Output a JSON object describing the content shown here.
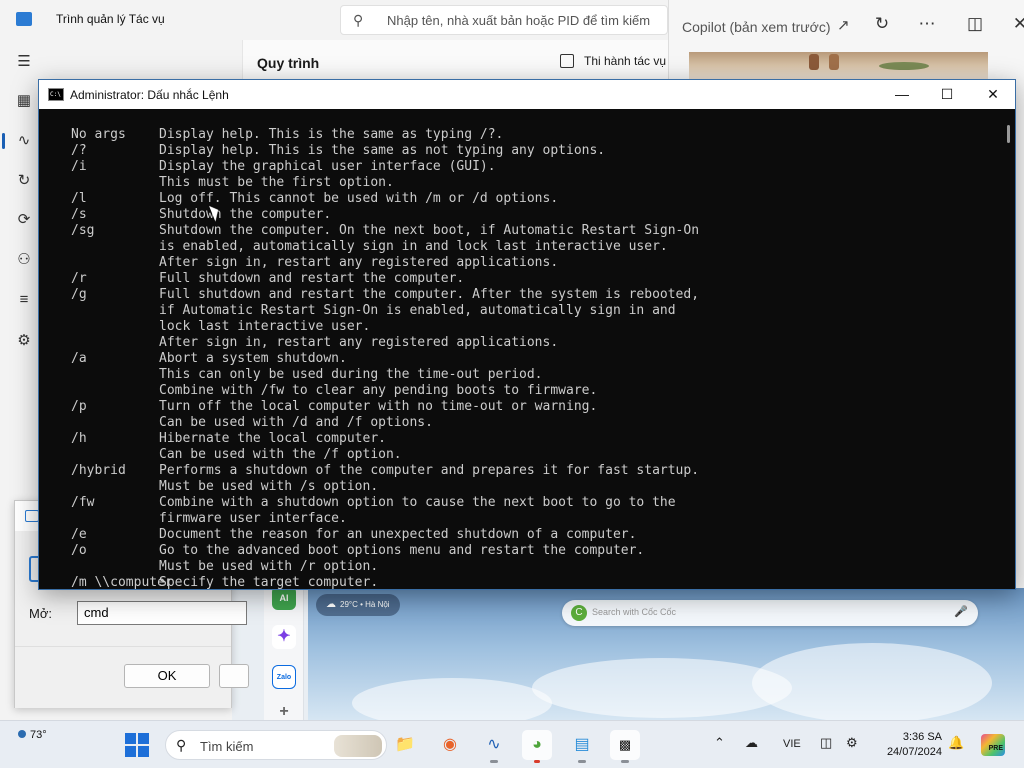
{
  "task_manager": {
    "title": "Trình quản lý Tác vụ",
    "search_placeholder": "Nhập tên, nhà xuất bản hoặc PID để tìm kiếm",
    "section_title": "Quy trình",
    "run_task_label": "Thi hành tác vụ",
    "nav_icons": [
      "hamburger-icon",
      "processes-icon",
      "performance-icon",
      "history-icon",
      "startup-icon",
      "users-icon",
      "details-icon",
      "services-icon"
    ]
  },
  "copilot": {
    "title": "Copilot (bản xem trước)"
  },
  "cmd": {
    "title": "Administrator: Dấu nhắc Lệnh",
    "lines": [
      {
        "sw": "No args",
        "desc": "Display help. This is the same as typing /?."
      },
      {
        "sw": "/?",
        "desc": "Display help. This is the same as not typing any options."
      },
      {
        "sw": "/i",
        "desc": "Display the graphical user interface (GUI)."
      },
      {
        "sw": "",
        "desc": "This must be the first option."
      },
      {
        "sw": "/l",
        "desc": "Log off. This cannot be used with /m or /d options."
      },
      {
        "sw": "/s",
        "desc": "Shutdown the computer."
      },
      {
        "sw": "/sg",
        "desc": "Shutdown the computer. On the next boot, if Automatic Restart Sign-On"
      },
      {
        "sw": "",
        "desc": "is enabled, automatically sign in and lock last interactive user."
      },
      {
        "sw": "",
        "desc": "After sign in, restart any registered applications."
      },
      {
        "sw": "/r",
        "desc": "Full shutdown and restart the computer."
      },
      {
        "sw": "/g",
        "desc": "Full shutdown and restart the computer. After the system is rebooted,"
      },
      {
        "sw": "",
        "desc": "if Automatic Restart Sign-On is enabled, automatically sign in and"
      },
      {
        "sw": "",
        "desc": "lock last interactive user."
      },
      {
        "sw": "",
        "desc": "After sign in, restart any registered applications."
      },
      {
        "sw": "/a",
        "desc": "Abort a system shutdown."
      },
      {
        "sw": "",
        "desc": "This can only be used during the time-out period."
      },
      {
        "sw": "",
        "desc": "Combine with /fw to clear any pending boots to firmware."
      },
      {
        "sw": "/p",
        "desc": "Turn off the local computer with no time-out or warning."
      },
      {
        "sw": "",
        "desc": "Can be used with /d and /f options."
      },
      {
        "sw": "/h",
        "desc": "Hibernate the local computer."
      },
      {
        "sw": "",
        "desc": "Can be used with the /f option."
      },
      {
        "sw": "/hybrid",
        "desc": "Performs a shutdown of the computer and prepares it for fast startup."
      },
      {
        "sw": "",
        "desc": "Must be used with /s option."
      },
      {
        "sw": "/fw",
        "desc": "Combine with a shutdown option to cause the next boot to go to the"
      },
      {
        "sw": "",
        "desc": "firmware user interface."
      },
      {
        "sw": "/e",
        "desc": "Document the reason for an unexpected shutdown of a computer."
      },
      {
        "sw": "/o",
        "desc": "Go to the advanced boot options menu and restart the computer."
      },
      {
        "sw": "",
        "desc": "Must be used with /r option."
      },
      {
        "sw": "/m \\\\computer",
        "desc": "Specify the target computer."
      }
    ]
  },
  "run_dialog": {
    "open_label": "Mở:",
    "open_value": "cmd",
    "ok_label": "OK"
  },
  "desktop": {
    "weather": "29°C • Hà Nội",
    "search_placeholder": "Search with Cốc Cốc",
    "dock_apps": [
      "AI",
      "Messenger",
      "Zalo"
    ]
  },
  "taskbar": {
    "temperature": "73°",
    "search_label": "Tìm kiếm",
    "language": "VIE",
    "time": "3:36 SA",
    "date": "24/07/2024",
    "pre_badge": "PRE",
    "accent": "#1d6fd8"
  }
}
